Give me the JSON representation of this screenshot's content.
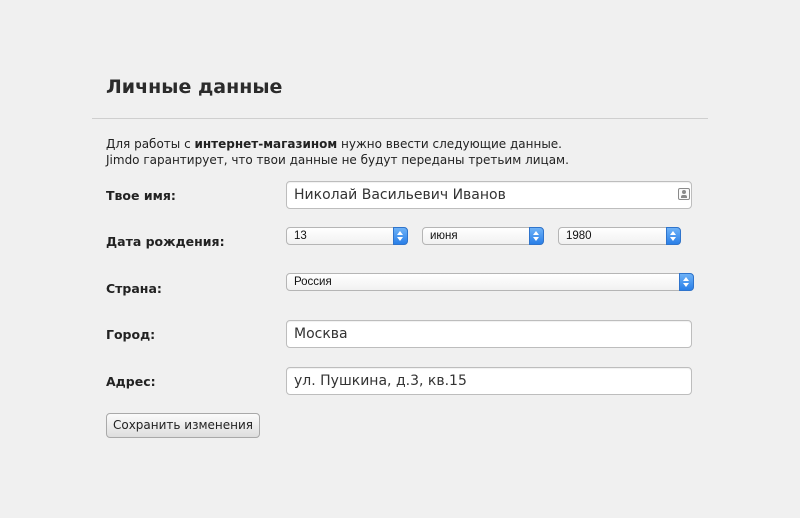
{
  "page": {
    "title": "Личные данные",
    "intro": {
      "line1_prefix": "Для работы с ",
      "line1_bold": "интернет-магазином",
      "line1_suffix": " нужно ввести следующие данные.",
      "line2": "Jimdo гарантирует, что твои данные не будут переданы третьим лицам."
    }
  },
  "form": {
    "name": {
      "label": "Твое имя:",
      "value": "Николай Васильевич Иванов",
      "icon": "contact-card-icon"
    },
    "birthdate": {
      "label": "Дата рождения:",
      "day": "13",
      "month": "июня",
      "year": "1980"
    },
    "country": {
      "label": "Страна:",
      "value": "Россия"
    },
    "city": {
      "label": "Город:",
      "value": "Москва"
    },
    "address": {
      "label": "Адрес:",
      "value": "ул. Пушкина, д.3, кв.15"
    },
    "save_label": "Сохранить изменения"
  },
  "colors": {
    "background": "#f0f0f0",
    "select_accent": "#2a7fe8"
  }
}
